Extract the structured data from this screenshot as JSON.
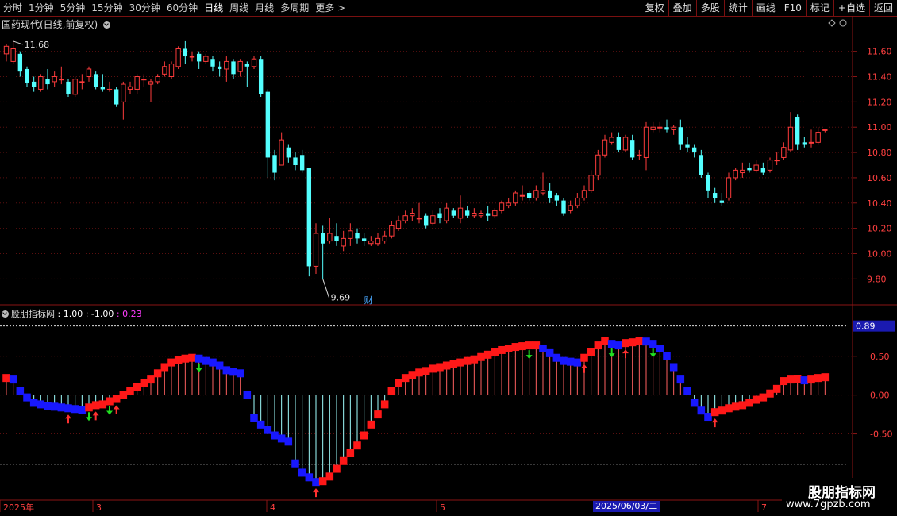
{
  "toolbar": {
    "periods": [
      "分时",
      "1分钟",
      "5分钟",
      "15分钟",
      "30分钟",
      "60分钟",
      "日线",
      "周线",
      "月线",
      "多周期",
      "更多 >"
    ],
    "active_period": "日线",
    "actions": [
      "复权",
      "叠加",
      "多股",
      "统计",
      "画线",
      "F10",
      "标记",
      "+自选",
      "返回"
    ]
  },
  "main_chart": {
    "title": "国药现代(日线,前复权)",
    "high_label": "11.68",
    "low_label": "9.69",
    "fin_marker": "财",
    "y_ticks": [
      "11.60",
      "11.40",
      "11.20",
      "11.00",
      "10.80",
      "10.60",
      "10.40",
      "10.20",
      "10.00",
      "9.80"
    ],
    "up_color": "#ff3c3c",
    "down_color": "#54ffff"
  },
  "indicator": {
    "name": "股朋指标网",
    "v1": ": 1.00",
    "v2": ": -1.00",
    "v3": ": 0.23",
    "y_ticks": [
      "0.50",
      "0.00",
      "-0.50"
    ],
    "current_value": "0.89"
  },
  "x_axis": {
    "labels": [
      "2025年",
      "3",
      "4",
      "5",
      "6",
      "7"
    ],
    "cursor_date": "2025/06/03/二"
  },
  "watermark": {
    "title": "股朋指标网",
    "url": "www.7gpzb.com"
  },
  "chart_data": {
    "type": "candlestick",
    "y_range": [
      9.62,
      11.78
    ],
    "candles": [
      [
        11.58,
        11.64,
        11.52,
        11.66
      ],
      [
        11.52,
        11.62,
        11.5,
        11.68
      ],
      [
        11.58,
        11.44,
        11.4,
        11.6
      ],
      [
        11.46,
        11.35,
        11.32,
        11.48
      ],
      [
        11.36,
        11.32,
        11.28,
        11.4
      ],
      [
        11.3,
        11.4,
        11.28,
        11.42
      ],
      [
        11.38,
        11.34,
        11.3,
        11.46
      ],
      [
        11.36,
        11.4,
        11.32,
        11.44
      ],
      [
        11.38,
        11.38,
        11.34,
        11.48
      ],
      [
        11.36,
        11.26,
        11.24,
        11.38
      ],
      [
        11.26,
        11.38,
        11.24,
        11.4
      ],
      [
        11.36,
        11.36,
        11.3,
        11.42
      ],
      [
        11.4,
        11.46,
        11.36,
        11.48
      ],
      [
        11.42,
        11.32,
        11.3,
        11.44
      ],
      [
        11.32,
        11.3,
        11.28,
        11.42
      ],
      [
        11.3,
        11.3,
        11.28,
        11.36
      ],
      [
        11.3,
        11.18,
        11.16,
        11.32
      ],
      [
        11.2,
        11.34,
        11.06,
        11.36
      ],
      [
        11.3,
        11.32,
        11.26,
        11.36
      ],
      [
        11.3,
        11.4,
        11.26,
        11.42
      ],
      [
        11.38,
        11.38,
        11.32,
        11.42
      ],
      [
        11.34,
        11.36,
        11.2,
        11.38
      ],
      [
        11.36,
        11.4,
        11.34,
        11.42
      ],
      [
        11.42,
        11.48,
        11.4,
        11.52
      ],
      [
        11.4,
        11.5,
        11.38,
        11.52
      ],
      [
        11.48,
        11.62,
        11.46,
        11.64
      ],
      [
        11.62,
        11.56,
        11.5,
        11.68
      ],
      [
        11.56,
        11.56,
        11.52,
        11.6
      ],
      [
        11.58,
        11.52,
        11.46,
        11.6
      ],
      [
        11.52,
        11.56,
        11.5,
        11.58
      ],
      [
        11.54,
        11.48,
        11.44,
        11.56
      ],
      [
        11.48,
        11.46,
        11.4,
        11.52
      ],
      [
        11.46,
        11.52,
        11.36,
        11.56
      ],
      [
        11.52,
        11.42,
        11.38,
        11.54
      ],
      [
        11.44,
        11.52,
        11.4,
        11.54
      ],
      [
        11.5,
        11.48,
        11.32,
        11.52
      ],
      [
        11.48,
        11.54,
        11.46,
        11.56
      ],
      [
        11.54,
        11.26,
        11.24,
        11.56
      ],
      [
        11.28,
        10.76,
        10.6,
        11.3
      ],
      [
        10.78,
        10.64,
        10.58,
        10.82
      ],
      [
        10.7,
        10.9,
        10.7,
        10.96
      ],
      [
        10.84,
        10.76,
        10.72,
        10.86
      ],
      [
        10.76,
        10.7,
        10.66,
        10.8
      ],
      [
        10.78,
        10.66,
        10.64,
        10.82
      ],
      [
        10.68,
        9.9,
        9.82,
        10.46
      ],
      [
        9.9,
        10.16,
        9.84,
        10.24
      ],
      [
        10.16,
        10.08,
        9.8,
        10.22
      ],
      [
        10.1,
        10.16,
        10.08,
        10.28
      ],
      [
        10.14,
        10.1,
        10.06,
        10.24
      ],
      [
        10.06,
        10.12,
        10.02,
        10.18
      ],
      [
        10.12,
        10.18,
        10.06,
        10.24
      ],
      [
        10.16,
        10.12,
        10.08,
        10.2
      ],
      [
        10.12,
        10.1,
        10.06,
        10.16
      ],
      [
        10.08,
        10.1,
        10.06,
        10.14
      ],
      [
        10.08,
        10.12,
        10.06,
        10.16
      ],
      [
        10.1,
        10.14,
        10.08,
        10.18
      ],
      [
        10.14,
        10.22,
        10.12,
        10.26
      ],
      [
        10.2,
        10.26,
        10.18,
        10.3
      ],
      [
        10.26,
        10.3,
        10.24,
        10.34
      ],
      [
        10.3,
        10.32,
        10.26,
        10.36
      ],
      [
        10.28,
        10.28,
        10.24,
        10.4
      ],
      [
        10.3,
        10.22,
        10.2,
        10.32
      ],
      [
        10.24,
        10.3,
        10.22,
        10.34
      ],
      [
        10.32,
        10.28,
        10.24,
        10.36
      ],
      [
        10.26,
        10.36,
        10.24,
        10.4
      ],
      [
        10.34,
        10.3,
        10.28,
        10.36
      ],
      [
        10.28,
        10.36,
        10.24,
        10.46
      ],
      [
        10.34,
        10.3,
        10.28,
        10.38
      ],
      [
        10.3,
        10.32,
        10.28,
        10.36
      ],
      [
        10.3,
        10.32,
        10.28,
        10.34
      ],
      [
        10.32,
        10.3,
        10.26,
        10.38
      ],
      [
        10.3,
        10.34,
        10.28,
        10.36
      ],
      [
        10.34,
        10.4,
        10.32,
        10.42
      ],
      [
        10.38,
        10.4,
        10.36,
        10.44
      ],
      [
        10.4,
        10.48,
        10.38,
        10.5
      ],
      [
        10.46,
        10.46,
        10.42,
        10.54
      ],
      [
        10.48,
        10.44,
        10.42,
        10.5
      ],
      [
        10.44,
        10.5,
        10.42,
        10.54
      ],
      [
        10.48,
        10.5,
        10.46,
        10.64
      ],
      [
        10.5,
        10.44,
        10.4,
        10.56
      ],
      [
        10.46,
        10.42,
        10.38,
        10.48
      ],
      [
        10.42,
        10.32,
        10.3,
        10.44
      ],
      [
        10.34,
        10.38,
        10.32,
        10.42
      ],
      [
        10.38,
        10.44,
        10.36,
        10.48
      ],
      [
        10.44,
        10.5,
        10.42,
        10.54
      ],
      [
        10.5,
        10.62,
        10.48,
        10.66
      ],
      [
        10.62,
        10.78,
        10.58,
        10.82
      ],
      [
        10.78,
        10.9,
        10.76,
        10.94
      ],
      [
        10.88,
        10.92,
        10.86,
        10.96
      ],
      [
        10.92,
        10.82,
        10.8,
        10.96
      ],
      [
        10.82,
        10.92,
        10.8,
        10.94
      ],
      [
        10.9,
        10.76,
        10.74,
        10.94
      ],
      [
        10.78,
        10.78,
        10.74,
        10.82
      ],
      [
        10.76,
        11.0,
        10.66,
        11.04
      ],
      [
        10.98,
        11.0,
        10.96,
        11.04
      ],
      [
        11.0,
        11.0,
        10.96,
        11.04
      ],
      [
        11.0,
        10.98,
        10.96,
        11.06
      ],
      [
        10.98,
        11.0,
        10.94,
        11.02
      ],
      [
        11.0,
        10.86,
        10.82,
        11.06
      ],
      [
        10.86,
        10.84,
        10.8,
        10.92
      ],
      [
        10.84,
        10.8,
        10.76,
        10.86
      ],
      [
        10.78,
        10.62,
        10.6,
        10.82
      ],
      [
        10.62,
        10.5,
        10.44,
        10.64
      ],
      [
        10.48,
        10.44,
        10.4,
        10.52
      ],
      [
        10.42,
        10.4,
        10.38,
        10.48
      ],
      [
        10.44,
        10.6,
        10.42,
        10.64
      ],
      [
        10.6,
        10.66,
        10.58,
        10.68
      ],
      [
        10.64,
        10.66,
        10.6,
        10.72
      ],
      [
        10.68,
        10.66,
        10.64,
        10.72
      ],
      [
        10.66,
        10.7,
        10.64,
        10.74
      ],
      [
        10.68,
        10.64,
        10.62,
        10.72
      ],
      [
        10.66,
        10.74,
        10.64,
        10.76
      ],
      [
        10.74,
        10.74,
        10.7,
        10.8
      ],
      [
        10.76,
        10.84,
        10.74,
        10.88
      ],
      [
        10.82,
        11.0,
        10.8,
        11.12
      ],
      [
        11.08,
        10.86,
        10.82,
        11.1
      ],
      [
        10.88,
        10.86,
        10.84,
        10.92
      ],
      [
        10.88,
        10.88,
        10.84,
        10.98
      ],
      [
        10.88,
        10.96,
        10.86,
        11.0
      ],
      [
        10.98,
        10.98,
        10.96,
        10.98
      ]
    ],
    "indicator_values": [
      0.22,
      0.2,
      0.05,
      -0.03,
      -0.1,
      -0.12,
      -0.14,
      -0.15,
      -0.16,
      -0.17,
      -0.18,
      -0.19,
      -0.16,
      -0.13,
      -0.12,
      -0.08,
      -0.05,
      0.0,
      0.05,
      0.1,
      0.15,
      0.2,
      0.28,
      0.36,
      0.42,
      0.45,
      0.47,
      0.48,
      0.47,
      0.44,
      0.42,
      0.38,
      0.32,
      0.3,
      0.28,
      0.0,
      -0.3,
      -0.38,
      -0.45,
      -0.52,
      -0.56,
      -0.6,
      -0.88,
      -1.0,
      -1.06,
      -1.12,
      -1.11,
      -1.05,
      -0.95,
      -0.85,
      -0.75,
      -0.65,
      -0.52,
      -0.38,
      -0.25,
      -0.12,
      0.05,
      0.15,
      0.22,
      0.26,
      0.29,
      0.31,
      0.34,
      0.36,
      0.38,
      0.4,
      0.42,
      0.44,
      0.46,
      0.49,
      0.52,
      0.55,
      0.58,
      0.6,
      0.62,
      0.63,
      0.64,
      0.64,
      0.6,
      0.54,
      0.48,
      0.44,
      0.43,
      0.42,
      0.48,
      0.55,
      0.64,
      0.7,
      0.66,
      0.64,
      0.67,
      0.68,
      0.7,
      0.69,
      0.66,
      0.6,
      0.5,
      0.36,
      0.2,
      0.05,
      -0.1,
      -0.2,
      -0.28,
      -0.22,
      -0.2,
      -0.17,
      -0.15,
      -0.13,
      -0.1,
      -0.06,
      -0.03,
      0.02,
      0.08,
      0.18,
      0.2,
      0.21,
      0.19,
      0.2,
      0.22,
      0.23
    ],
    "indicator_levels": {
      "upper": 0.89,
      "lower": -0.89
    },
    "indicator_y_range": [
      -1.2,
      1.05
    ],
    "arrows": [
      {
        "i": 9,
        "dir": "up"
      },
      {
        "i": 12,
        "dir": "down"
      },
      {
        "i": 13,
        "dir": "up"
      },
      {
        "i": 15,
        "dir": "down"
      },
      {
        "i": 16,
        "dir": "up"
      },
      {
        "i": 28,
        "dir": "down"
      },
      {
        "i": 45,
        "dir": "up"
      },
      {
        "i": 76,
        "dir": "down"
      },
      {
        "i": 84,
        "dir": "up"
      },
      {
        "i": 88,
        "dir": "down"
      },
      {
        "i": 90,
        "dir": "up"
      },
      {
        "i": 94,
        "dir": "down"
      },
      {
        "i": 103,
        "dir": "up"
      }
    ]
  }
}
